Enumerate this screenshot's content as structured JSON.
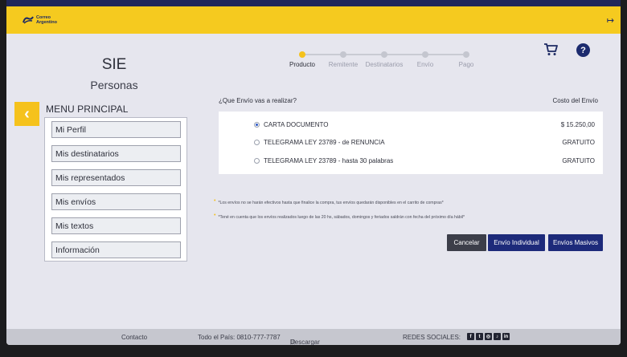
{
  "header": {
    "logo_text": "Correo Argentino",
    "logout_icon": "logout-icon"
  },
  "app": {
    "title": "SIE",
    "subtitle": "Personas"
  },
  "menu": {
    "back_icon": "chevron-left-icon",
    "title": "MENU PRINCIPAL",
    "items": [
      {
        "label": "Mi Perfil"
      },
      {
        "label": "Mis destinatarios"
      },
      {
        "label": "Mis representados"
      },
      {
        "label": "Mis envíos"
      },
      {
        "label": "Mis textos"
      },
      {
        "label": "Información"
      }
    ]
  },
  "stepper": {
    "steps": [
      {
        "label": "Producto",
        "active": true
      },
      {
        "label": "Remitente",
        "active": false
      },
      {
        "label": "Destinatarios",
        "active": false
      },
      {
        "label": "Envío",
        "active": false
      },
      {
        "label": "Pago",
        "active": false
      }
    ]
  },
  "icons": {
    "cart": "cart-icon",
    "help": "help-icon",
    "help_glyph": "?"
  },
  "form": {
    "question": "¿Que Envío vas a realizar?",
    "cost_header": "Costo del Envío",
    "options": [
      {
        "label": "CARTA DOCUMENTO",
        "price": "$ 15.250,00",
        "selected": true
      },
      {
        "label": "TELEGRAMA LEY 23789 - de RENUNCIA",
        "price": "GRATUITO",
        "selected": false
      },
      {
        "label": "TELEGRAMA LEY 23789 - hasta 30 palabras",
        "price": "GRATUITO",
        "selected": false
      }
    ]
  },
  "notes": [
    "*Los envíos no se harán efectivos hasta que finalice la compra, tus envíos quedarán disponibles en el carrito de compras*",
    "*Tené en cuenta que los envíos realizados luego de las 20 hs, sábados, domingos y feriados saldrán con fecha del próximo día hábil*"
  ],
  "actions": {
    "cancel": "Cancelar",
    "individual": "Envío Individual",
    "masivos": "Envíos Masivos"
  },
  "footer": {
    "contacto": "Contacto",
    "phone": "Todo el País: 0810-777-7787",
    "manual": "Descargar Manual de Usuarios",
    "social_label": "REDES SOCIALES:",
    "social_icons": [
      "facebook-icon",
      "twitter-icon",
      "instagram-icon",
      "tiktok-icon",
      "linkedin-icon"
    ]
  },
  "colors": {
    "accent": "#f5ca1f",
    "primary": "#1d2a7a",
    "background": "#e6e6ee"
  }
}
